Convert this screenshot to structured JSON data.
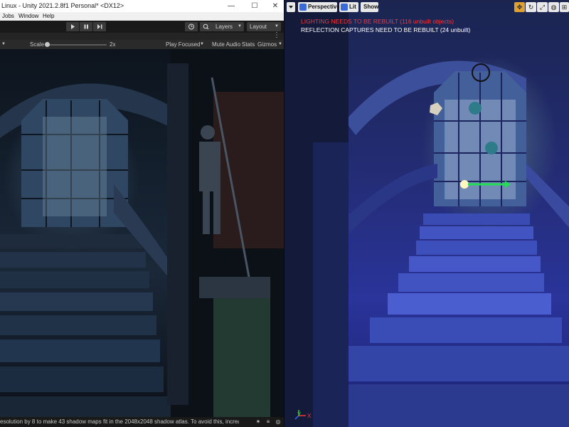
{
  "unity": {
    "title": "Linux - Unity 2021.2.8f1 Personal* <DX12>",
    "window_buttons": {
      "minimize": "—",
      "maximize": "☐",
      "close": "✕"
    },
    "menu": [
      "Jobs",
      "Window",
      "Help"
    ],
    "toolbar": {
      "play_icon": "play-icon",
      "pause_icon": "pause-icon",
      "step_icon": "step-icon",
      "history_icon": "history-icon",
      "search_icon": "search-icon",
      "layers_label": "Layers",
      "layout_label": "Layout"
    },
    "game_bar": {
      "scale_label": "Scale",
      "scale_value": "2x",
      "play_focused": "Play Focused",
      "mute_audio": "Mute Audio",
      "stats": "Stats",
      "gizmos": "Gizmos"
    },
    "status_message": "esolution by 8 to make 43 shadow maps fit in the 2048x2048 shadow atlas. To avoid this, increase sha"
  },
  "unreal": {
    "toolbar": {
      "menu_icon": "dropdown-icon",
      "perspective_label": "Perspective",
      "lit_label": "Lit",
      "show_label": "Show"
    },
    "warnings": [
      {
        "text": "LIGHTING NEEDS TO BE REBUILT (116 unbuilt objects)",
        "color": "#ff3333"
      },
      {
        "text": "REFLECTION CAPTURES NEED TO BE REBUILT (24 unbuilt)",
        "color": "#ffffff"
      }
    ],
    "axis": {
      "y": "Y",
      "x": "X"
    }
  },
  "colors": {
    "unity_bg": "#191919",
    "unreal_accent": "#3a6ad8",
    "warning_red": "#ff3333",
    "light_arrow": "#22dd55"
  }
}
